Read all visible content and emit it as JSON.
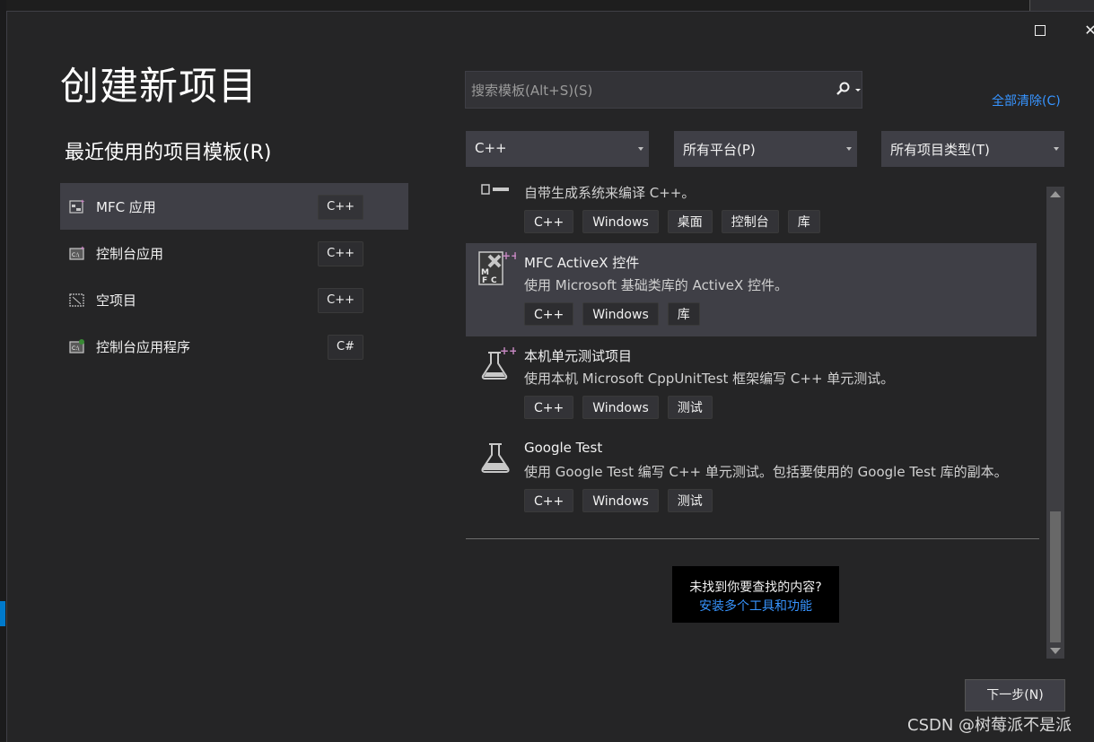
{
  "window": {
    "title": "创建新项目",
    "recent_heading": "最近使用的项目模板(R)"
  },
  "recent": [
    {
      "label": "MFC 应用",
      "tag": "C++",
      "icon": "mfc-app-icon",
      "selected": true
    },
    {
      "label": "控制台应用",
      "tag": "C++",
      "icon": "console-app-icon",
      "selected": false
    },
    {
      "label": "空项目",
      "tag": "C++",
      "icon": "empty-project-icon",
      "selected": false
    },
    {
      "label": "控制台应用程序",
      "tag": "C#",
      "icon": "csharp-console-icon",
      "selected": false
    }
  ],
  "search": {
    "placeholder": "搜索模板(Alt+S)(S)",
    "value": ""
  },
  "clear_all": "全部清除(C)",
  "filters": {
    "language": "C++",
    "platform": "所有平台(P)",
    "project_type": "所有项目类型(T)"
  },
  "templates": [
    {
      "name": "",
      "desc": "自带生成系统来编译 C++。",
      "tags": [
        "C++",
        "Windows",
        "桌面",
        "控制台",
        "库"
      ],
      "icon": "cmake-project-icon"
    },
    {
      "name": "MFC ActiveX 控件",
      "desc": "使用 Microsoft 基础类库的 ActiveX 控件。",
      "tags": [
        "C++",
        "Windows",
        "库"
      ],
      "icon": "mfc-activex-icon",
      "selected": true
    },
    {
      "name": "本机单元测试项目",
      "desc": "使用本机 Microsoft CppUnitTest 框架编写 C++ 单元测试。",
      "tags": [
        "C++",
        "Windows",
        "测试"
      ],
      "icon": "native-unit-test-icon"
    },
    {
      "name": "Google Test",
      "desc": "使用 Google Test 编写 C++ 单元测试。包括要使用的 Google Test 库的副本。",
      "tags": [
        "C++",
        "Windows",
        "测试"
      ],
      "icon": "google-test-flask-icon"
    }
  ],
  "not_found": {
    "question": "未找到你要查找的内容?",
    "link": "安装多个工具和功能"
  },
  "next_button": "下一步(N)",
  "watermark": "CSDN @树莓派不是派",
  "colors": {
    "background": "#252526",
    "selected": "#3f3f46",
    "link": "#3794ff",
    "accent_purple": "#c586c0"
  }
}
